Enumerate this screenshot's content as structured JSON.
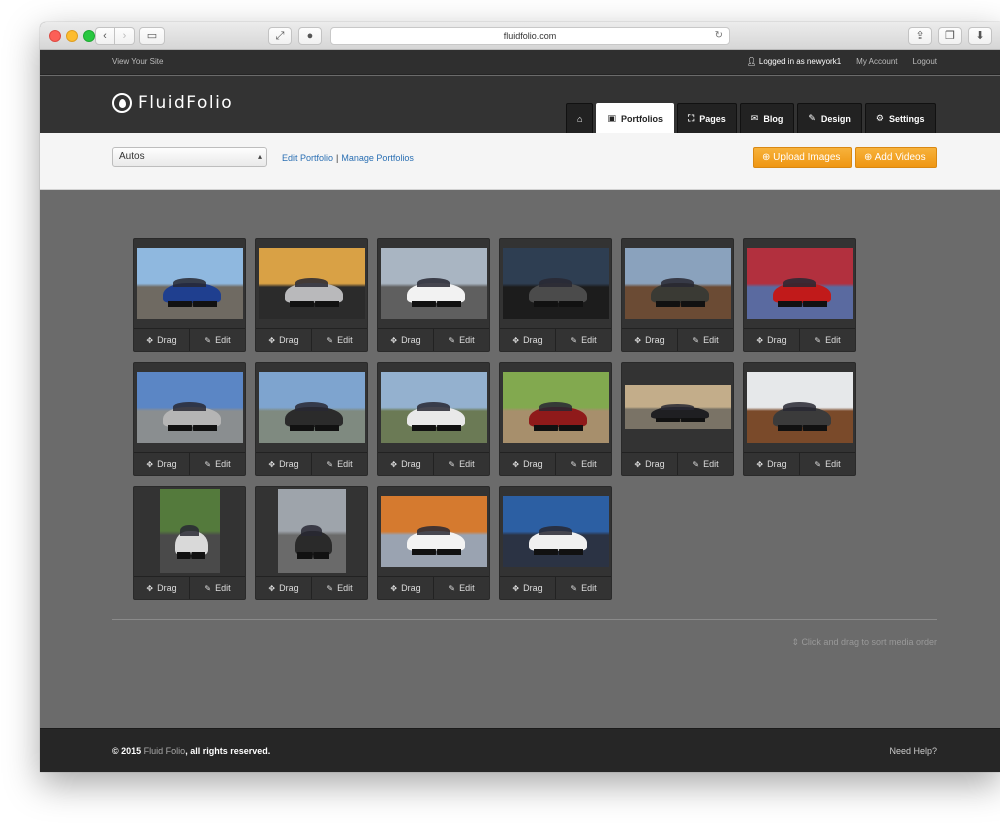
{
  "browser": {
    "url": "fluidfolio.com"
  },
  "topbar": {
    "view_site": "View Your Site",
    "logged_in": "Logged in as newyork1",
    "my_account": "My Account",
    "logout": "Logout"
  },
  "header": {
    "logo_text": "FluidFolio",
    "tabs": [
      {
        "label": "",
        "icon": "home-icon",
        "active": false
      },
      {
        "label": "Portfolios",
        "icon": "briefcase-icon",
        "active": true
      },
      {
        "label": "Pages",
        "icon": "sitemap-icon",
        "active": false
      },
      {
        "label": "Blog",
        "icon": "blog-icon",
        "active": false
      },
      {
        "label": "Design",
        "icon": "edit-icon",
        "active": false
      },
      {
        "label": "Settings",
        "icon": "gears-icon",
        "active": false
      }
    ]
  },
  "toolbar": {
    "portfolio_select": "Autos",
    "edit_portfolio": "Edit Portfolio",
    "separator": "|",
    "manage_portfolios": "Manage Portfolios",
    "upload_images": "Upload Images",
    "add_videos": "Add Videos"
  },
  "grid": {
    "drag_label": "Drag",
    "edit_label": "Edit",
    "items": [
      {
        "sky": "#8fb8df",
        "ground": "#6f6a62",
        "car": "#1f3f8f"
      },
      {
        "sky": "#d9a145",
        "ground": "#2b2b2b",
        "car": "#b9b9bb"
      },
      {
        "sky": "#a9b5c2",
        "ground": "#5f5f5f",
        "car": "#f2f2f2"
      },
      {
        "sky": "#2e3e52",
        "ground": "#1c1c1c",
        "car": "#4b4b4b"
      },
      {
        "sky": "#8aa2bd",
        "ground": "#6b4b34",
        "car": "#3a3a34"
      },
      {
        "sky": "#b2303e",
        "ground": "#5a6aa0",
        "car": "#c11a1a"
      },
      {
        "sky": "#5b86c5",
        "ground": "#8a8e90",
        "car": "#b5b5b5"
      },
      {
        "sky": "#7ea4cf",
        "ground": "#7f8a80",
        "car": "#2b2b2b"
      },
      {
        "sky": "#94b1cf",
        "ground": "#6b7a55",
        "car": "#e9e9e9"
      },
      {
        "sky": "#82a94f",
        "ground": "#a78f6c",
        "car": "#8f1a1a"
      },
      {
        "sky": "#c3ad8a",
        "ground": "#7a7366",
        "car": "#1f1f22",
        "wide": true
      },
      {
        "sky": "#e6e8ea",
        "ground": "#7a4a2a",
        "car": "#3b3b3b"
      },
      {
        "sky": "#547a3c",
        "ground": "#4a4a4a",
        "car": "#d9d9d9",
        "tall": true
      },
      {
        "sky": "#9ea4ab",
        "ground": "#6a6a6a",
        "car": "#2a2a2a",
        "tall": true
      },
      {
        "sky": "#d57a2f",
        "ground": "#9aa3b1",
        "car": "#f3f3f3"
      },
      {
        "sky": "#2c5fa3",
        "ground": "#2b3344",
        "car": "#f0f0f0"
      }
    ]
  },
  "sort_hint": "Click and drag to sort media order",
  "footer": {
    "copy_prefix": "© 2015",
    "brand": "Fluid Folio",
    "copy_suffix": ", all rights reserved.",
    "need_help": "Need Help?"
  }
}
